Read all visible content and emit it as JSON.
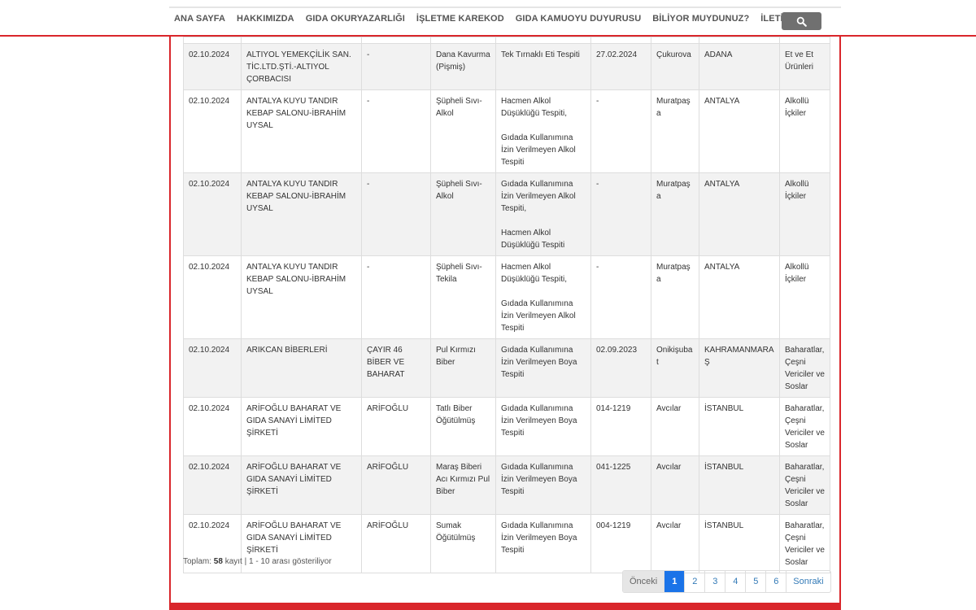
{
  "nav": {
    "items": [
      "ANA SAYFA",
      "HAKKIMIZDA",
      "GIDA OKURYAZARLIĞI",
      "İŞLETME KAREKOD",
      "GIDA KAMUOYU DUYURUSU",
      "BİLİYOR MUYDUNUZ?",
      "İLETİŞİM"
    ],
    "search_icon": "search-icon"
  },
  "table": {
    "rows": [
      {
        "date": "02.10.2024",
        "company": "ALTIYOL YEMEKÇİLİK SAN. TİC.LTD.ŞTİ.-ALTIYOL ÇORBACISI",
        "brand": "-",
        "product": "Dana Kavurma (Pişmiş)",
        "issue": [
          "Tek Tırnaklı Eti Tespiti"
        ],
        "batch": "27.02.2024",
        "district": "Çukurova",
        "city": "ADANA",
        "group": "Et ve Et Ürünleri"
      },
      {
        "date": "02.10.2024",
        "company": "ANTALYA KUYU TANDIR KEBAP SALONU-İBRAHİM UYSAL",
        "brand": "-",
        "product": "Şüpheli Sıvı-Alkol",
        "issue": [
          "Hacmen Alkol Düşüklüğü Tespiti,",
          "Gıdada Kullanımına İzin Verilmeyen Alkol Tespiti"
        ],
        "batch": "-",
        "district": "Muratpaşa",
        "city": "ANTALYA",
        "group": "Alkollü İçkiler"
      },
      {
        "date": "02.10.2024",
        "company": "ANTALYA KUYU TANDIR KEBAP SALONU-İBRAHİM UYSAL",
        "brand": "-",
        "product": "Şüpheli Sıvı-Alkol",
        "issue": [
          "Gıdada Kullanımına İzin Verilmeyen Alkol Tespiti,",
          "Hacmen Alkol Düşüklüğü Tespiti"
        ],
        "batch": "-",
        "district": "Muratpaşa",
        "city": "ANTALYA",
        "group": "Alkollü İçkiler"
      },
      {
        "date": "02.10.2024",
        "company": "ANTALYA KUYU TANDIR KEBAP SALONU-İBRAHİM UYSAL",
        "brand": "-",
        "product": "Şüpheli Sıvı-Tekila",
        "issue": [
          "Hacmen Alkol Düşüklüğü Tespiti,",
          "Gıdada Kullanımına İzin Verilmeyen Alkol Tespiti"
        ],
        "batch": "-",
        "district": "Muratpaşa",
        "city": "ANTALYA",
        "group": "Alkollü İçkiler"
      },
      {
        "date": "02.10.2024",
        "company": "ARIKCAN BİBERLERİ",
        "brand": "ÇAYIR 46 BİBER VE BAHARAT",
        "product": "Pul Kırmızı Biber",
        "issue": [
          "Gıdada Kullanımına İzin Verilmeyen Boya Tespiti"
        ],
        "batch": "02.09.2023",
        "district": "Onikişubat",
        "city": "KAHRAMANMARAŞ",
        "group": "Baharatlar, Çeşni Vericiler ve Soslar"
      },
      {
        "date": "02.10.2024",
        "company": "ARİFOĞLU BAHARAT VE GIDA SANAYİ LİMİTED ŞİRKETİ",
        "brand": "ARİFOĞLU",
        "product": "Tatlı Biber Öğütülmüş",
        "issue": [
          "Gıdada Kullanımına İzin Verilmeyen Boya Tespiti"
        ],
        "batch": "014-1219",
        "district": "Avcılar",
        "city": "İSTANBUL",
        "group": "Baharatlar, Çeşni Vericiler ve Soslar"
      },
      {
        "date": "02.10.2024",
        "company": "ARİFOĞLU BAHARAT VE GIDA SANAYİ LİMİTED ŞİRKETİ",
        "brand": "ARİFOĞLU",
        "product": "Maraş Biberi Acı Kırmızı Pul Biber",
        "issue": [
          "Gıdada Kullanımına İzin Verilmeyen Boya Tespiti"
        ],
        "batch": "041-1225",
        "district": "Avcılar",
        "city": "İSTANBUL",
        "group": "Baharatlar, Çeşni Vericiler ve Soslar"
      },
      {
        "date": "02.10.2024",
        "company": "ARİFOĞLU BAHARAT VE GIDA SANAYİ LİMİTED ŞİRKETİ",
        "brand": "ARİFOĞLU",
        "product": "Sumak Öğütülmüş",
        "issue": [
          "Gıdada Kullanımına İzin Verilmeyen Boya Tespiti"
        ],
        "batch": "004-1219",
        "district": "Avcılar",
        "city": "İSTANBUL",
        "group": "Baharatlar, Çeşni Vericiler ve Soslar"
      }
    ]
  },
  "footer": {
    "total_label": "Toplam:",
    "total_count": "58",
    "total_suffix": "kayıt | 1 - 10 arası gösteriliyor"
  },
  "pagination": {
    "prev": "Önceki",
    "pages": [
      "1",
      "2",
      "3",
      "4",
      "5",
      "6"
    ],
    "active": "1",
    "next": "Sonraki"
  },
  "colors": {
    "accent_red": "#d9262b",
    "active_page": "#1a73e8",
    "link": "#337ab7"
  }
}
